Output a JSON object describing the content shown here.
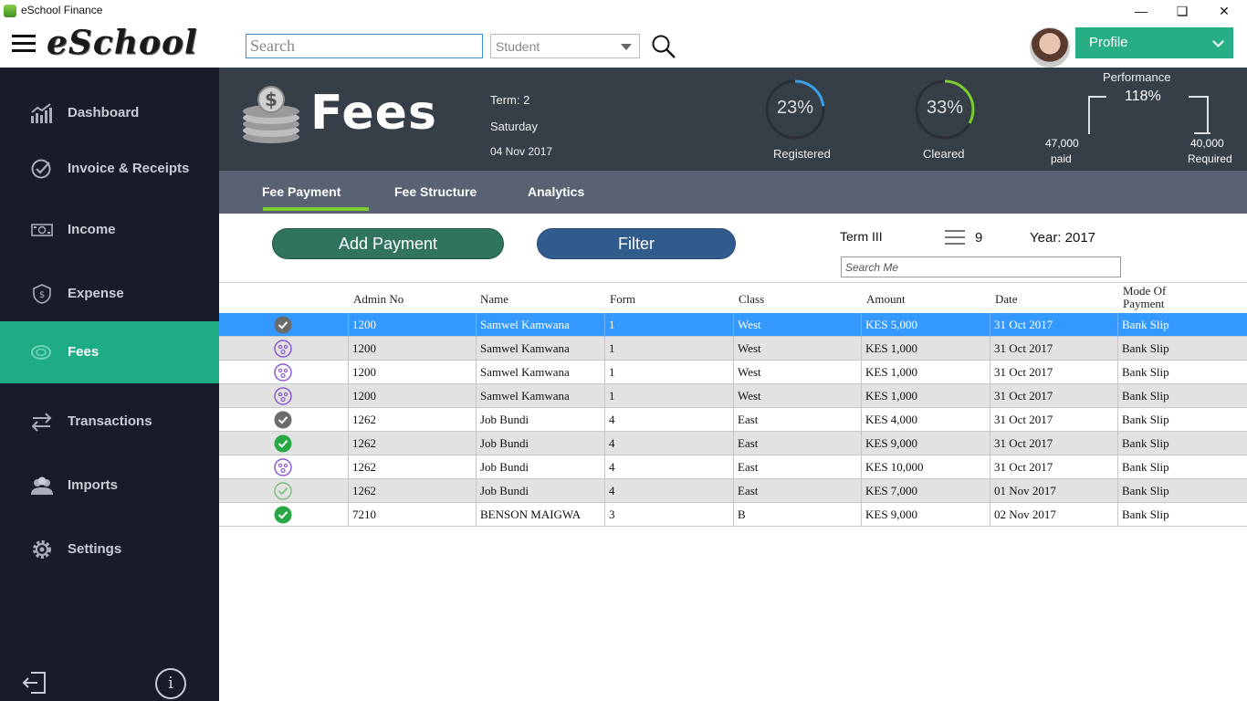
{
  "window": {
    "title": "eSchool Finance"
  },
  "header": {
    "logo": "eSchool",
    "search_placeholder": "Search",
    "search_type": "Student",
    "profile_label": "Profile"
  },
  "sidebar": {
    "items": [
      {
        "label": "Dashboard",
        "icon": "chart-icon"
      },
      {
        "label": "Invoice & Receipts",
        "icon": "check-circle-icon"
      },
      {
        "label": "Income",
        "icon": "banknote-icon"
      },
      {
        "label": "Expense",
        "icon": "money-shield-icon"
      },
      {
        "label": "Fees",
        "icon": "coin-icon",
        "active": true
      },
      {
        "label": "Transactions",
        "icon": "swap-arrows-icon"
      },
      {
        "label": "Imports",
        "icon": "users-icon"
      },
      {
        "label": "Settings",
        "icon": "gear-icon"
      }
    ]
  },
  "banner": {
    "title": "Fees",
    "term": "Term: 2",
    "day": "Saturday",
    "date": "04 Nov 2017",
    "registered": {
      "value": "23%",
      "label": "Registered",
      "fraction": 0.23,
      "color": "#3aa0e8"
    },
    "cleared": {
      "value": "33%",
      "label": "Cleared",
      "fraction": 0.33,
      "color": "#7ccd2e"
    },
    "performance": {
      "title": "Performance",
      "value": "118%",
      "paid_amount": "47,000",
      "paid_label": "paid",
      "required_amount": "40,000",
      "required_label": "Required"
    }
  },
  "tabs": [
    {
      "label": "Fee Payment",
      "active": true
    },
    {
      "label": "Fee Structure"
    },
    {
      "label": "Analytics"
    }
  ],
  "toolbar": {
    "add_label": "Add Payment",
    "filter_label": "Filter",
    "term": "Term III",
    "count": "9",
    "year": "Year: 2017",
    "search_placeholder": "Search Me"
  },
  "table": {
    "columns": [
      "Admin No",
      "Name",
      "Form",
      "Class",
      "Amount",
      "Date",
      "Mode Of Payment"
    ],
    "rows": [
      {
        "status": "check-gray",
        "admin": "1200",
        "name": "Samwel Kamwana",
        "form": "1",
        "class": "West",
        "amount": "KES 5,000",
        "date": "31 Oct 2017",
        "mode": "Bank Slip",
        "selected": true
      },
      {
        "status": "pending-purple",
        "admin": "1200",
        "name": "Samwel Kamwana",
        "form": "1",
        "class": "West",
        "amount": "KES 1,000",
        "date": "31 Oct 2017",
        "mode": "Bank Slip"
      },
      {
        "status": "pending-purple",
        "admin": "1200",
        "name": "Samwel Kamwana",
        "form": "1",
        "class": "West",
        "amount": "KES 1,000",
        "date": "31 Oct 2017",
        "mode": "Bank Slip"
      },
      {
        "status": "pending-purple",
        "admin": "1200",
        "name": "Samwel Kamwana",
        "form": "1",
        "class": "West",
        "amount": "KES 1,000",
        "date": "31 Oct 2017",
        "mode": "Bank Slip"
      },
      {
        "status": "check-gray",
        "admin": "1262",
        "name": "Job Bundi",
        "form": "4",
        "class": "East",
        "amount": "KES 4,000",
        "date": "31 Oct 2017",
        "mode": "Bank Slip"
      },
      {
        "status": "check-green",
        "admin": "1262",
        "name": "Job Bundi",
        "form": "4",
        "class": "East",
        "amount": "KES 9,000",
        "date": "31 Oct 2017",
        "mode": "Bank Slip"
      },
      {
        "status": "pending-purple",
        "admin": "1262",
        "name": "Job Bundi",
        "form": "4",
        "class": "East",
        "amount": "KES 10,000",
        "date": "31 Oct 2017",
        "mode": "Bank Slip"
      },
      {
        "status": "check-light",
        "admin": "1262",
        "name": "Job Bundi",
        "form": "4",
        "class": "East",
        "amount": "KES 7,000",
        "date": "01 Nov 2017",
        "mode": "Bank Slip"
      },
      {
        "status": "check-green",
        "admin": "7210",
        "name": "BENSON MAIGWA",
        "form": "3",
        "class": "B",
        "amount": "KES 9,000",
        "date": "02 Nov 2017",
        "mode": "Bank Slip"
      }
    ]
  }
}
